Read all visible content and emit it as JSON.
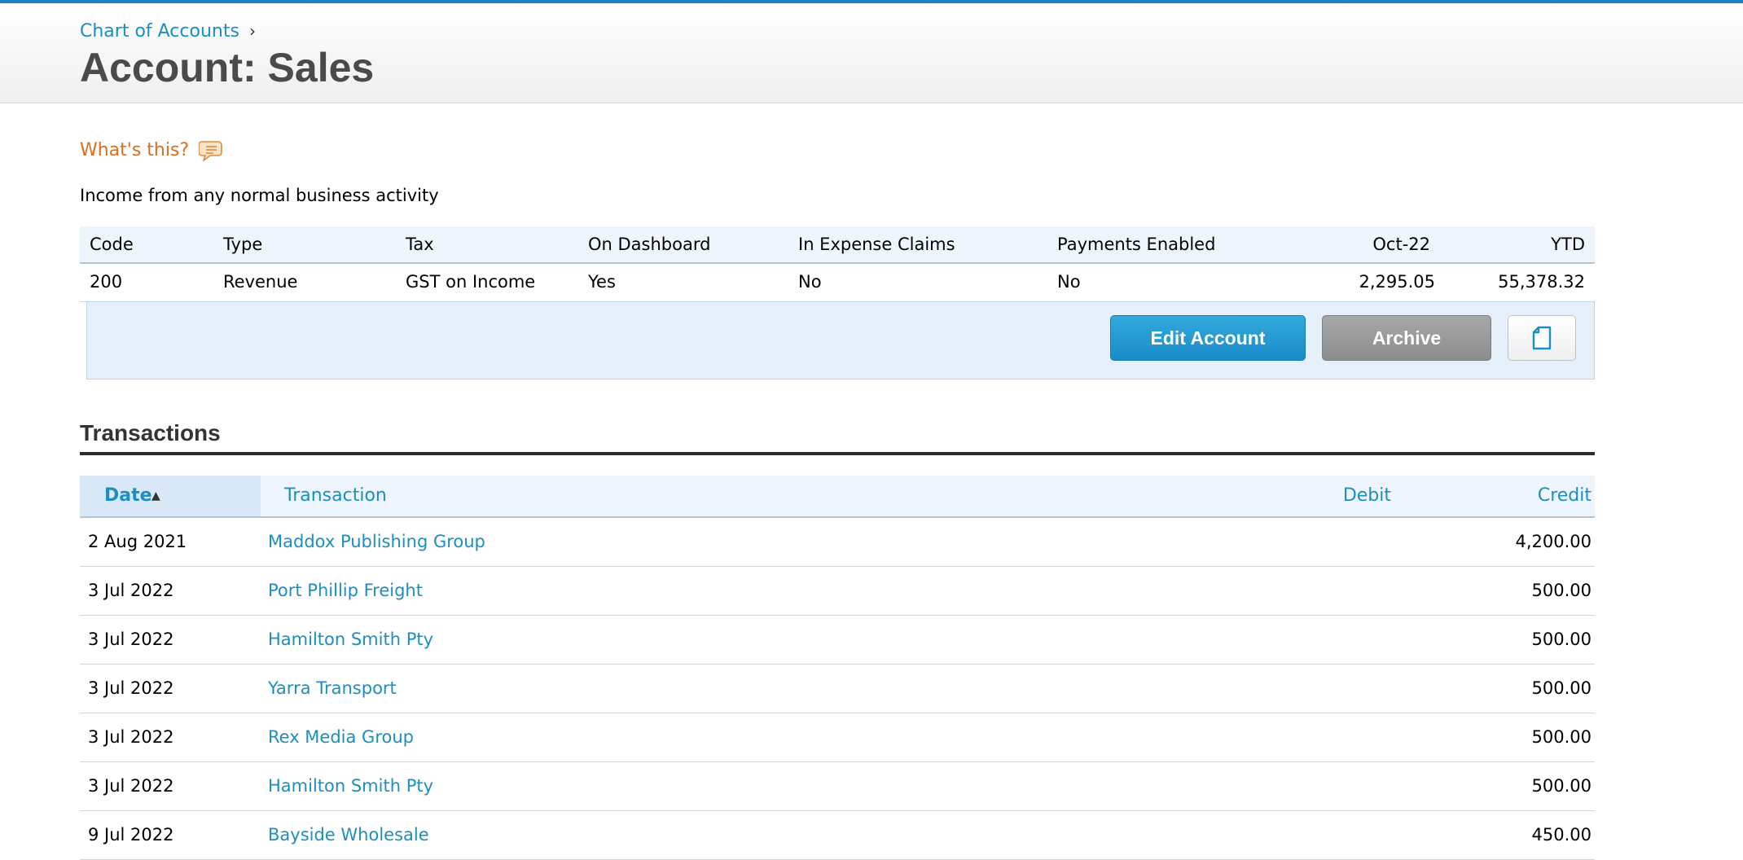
{
  "header": {
    "breadcrumb": "Chart of Accounts",
    "breadcrumb_sep": "›",
    "title": "Account: Sales"
  },
  "help": {
    "label": "What's this?",
    "icon": "speech-bubble-icon"
  },
  "description": "Income from any normal business activity",
  "account_info": {
    "headers": [
      "Code",
      "Type",
      "Tax",
      "On Dashboard",
      "In Expense Claims",
      "Payments Enabled",
      "Oct-22",
      "YTD"
    ],
    "values": [
      "200",
      "Revenue",
      "GST on Income",
      "Yes",
      "No",
      "No",
      "2,295.05",
      "55,378.32"
    ]
  },
  "actions": {
    "edit_label": "Edit Account",
    "archive_label": "Archive",
    "copy_icon": "document-copy-icon",
    "edit_color": "#1a8cc9",
    "archive_color": "#8d8d8d"
  },
  "transactions": {
    "section_title": "Transactions",
    "columns": {
      "date": "Date",
      "transaction": "Transaction",
      "debit": "Debit",
      "credit": "Credit"
    },
    "sort_indicator": "▲",
    "rows": [
      {
        "date": "2 Aug 2021",
        "transaction": "Maddox Publishing Group",
        "debit": "",
        "credit": "4,200.00"
      },
      {
        "date": "3 Jul 2022",
        "transaction": "Port Phillip Freight",
        "debit": "",
        "credit": "500.00"
      },
      {
        "date": "3 Jul 2022",
        "transaction": "Hamilton Smith Pty",
        "debit": "",
        "credit": "500.00"
      },
      {
        "date": "3 Jul 2022",
        "transaction": "Yarra Transport",
        "debit": "",
        "credit": "500.00"
      },
      {
        "date": "3 Jul 2022",
        "transaction": "Rex Media Group",
        "debit": "",
        "credit": "500.00"
      },
      {
        "date": "3 Jul 2022",
        "transaction": "Hamilton Smith Pty",
        "debit": "",
        "credit": "500.00"
      },
      {
        "date": "9 Jul 2022",
        "transaction": "Bayside Wholesale",
        "debit": "",
        "credit": "450.00"
      }
    ]
  }
}
